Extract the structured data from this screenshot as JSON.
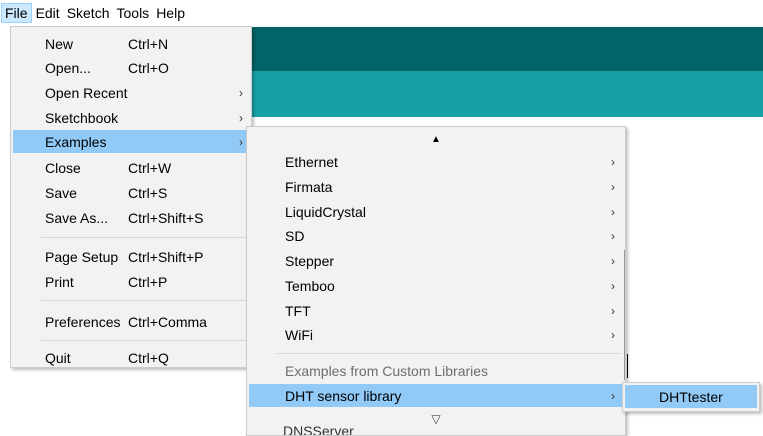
{
  "menubar": {
    "items": [
      {
        "label": "File"
      },
      {
        "label": "Edit"
      },
      {
        "label": "Sketch"
      },
      {
        "label": "Tools"
      },
      {
        "label": "Help"
      }
    ]
  },
  "file_menu": {
    "items": [
      {
        "label": "New",
        "shortcut": "Ctrl+N"
      },
      {
        "label": "Open...",
        "shortcut": "Ctrl+O"
      },
      {
        "label": "Open Recent",
        "arrow": "›"
      },
      {
        "label": "Sketchbook",
        "arrow": "›"
      },
      {
        "label": "Examples",
        "arrow": "›"
      },
      {
        "label": "Close",
        "shortcut": "Ctrl+W"
      },
      {
        "label": "Save",
        "shortcut": "Ctrl+S"
      },
      {
        "label": "Save As...",
        "shortcut": "Ctrl+Shift+S"
      },
      {
        "label": "Page Setup",
        "shortcut": "Ctrl+Shift+P"
      },
      {
        "label": "Print",
        "shortcut": "Ctrl+P"
      },
      {
        "label": "Preferences",
        "shortcut": "Ctrl+Comma"
      },
      {
        "label": "Quit",
        "shortcut": "Ctrl+Q"
      }
    ]
  },
  "examples_menu": {
    "scroll_up": "▲",
    "items": [
      {
        "label": "Ethernet",
        "arrow": "›"
      },
      {
        "label": "Firmata",
        "arrow": "›"
      },
      {
        "label": "LiquidCrystal",
        "arrow": "›"
      },
      {
        "label": "SD",
        "arrow": "›"
      },
      {
        "label": "Stepper",
        "arrow": "›"
      },
      {
        "label": "Temboo",
        "arrow": "›"
      },
      {
        "label": "TFT",
        "arrow": "›"
      },
      {
        "label": "WiFi",
        "arrow": "›"
      }
    ],
    "custom_section_label": "Examples from Custom Libraries",
    "dht_item": {
      "label": "DHT sensor library",
      "arrow": "›"
    },
    "scroll_down": "▽",
    "clipped_item": "DNSServer"
  },
  "dht_submenu": {
    "items": [
      {
        "label": "DHTtester"
      }
    ]
  },
  "colors": {
    "highlight": "#91c9f7",
    "menubar_active": "#cce8ff",
    "teal_dark": "#006468",
    "teal_light": "#17a1a5",
    "menu_bg": "#f2f2f2"
  }
}
